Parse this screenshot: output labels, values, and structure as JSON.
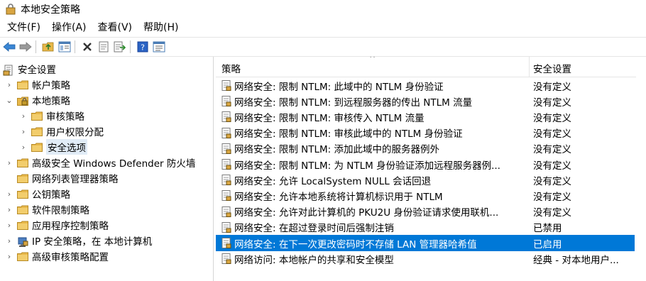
{
  "window": {
    "title": "本地安全策略"
  },
  "menu": [
    "文件(F)",
    "操作(A)",
    "查看(V)",
    "帮助(H)"
  ],
  "toolbar": {
    "icons": [
      "back-arrow-icon",
      "forward-arrow-icon",
      "up-folder-icon",
      "show-hide-tree-icon",
      "delete-icon",
      "properties-icon",
      "export-list-icon",
      "help-icon",
      "view-icon"
    ]
  },
  "tree": [
    {
      "label": "安全设置",
      "level": 0,
      "expanded": true
    },
    {
      "label": "帐户策略",
      "level": 1,
      "expanded": false
    },
    {
      "label": "本地策略",
      "level": 1,
      "expanded": true
    },
    {
      "label": "审核策略",
      "level": 2,
      "expanded": false
    },
    {
      "label": "用户权限分配",
      "level": 2,
      "expanded": false
    },
    {
      "label": "安全选项",
      "level": 2,
      "expanded": false,
      "selected": true
    },
    {
      "label": "高级安全 Windows Defender 防火墙",
      "level": 1,
      "expanded": false
    },
    {
      "label": "网络列表管理器策略",
      "level": 1,
      "expanded": null
    },
    {
      "label": "公钥策略",
      "level": 1,
      "expanded": false
    },
    {
      "label": "软件限制策略",
      "level": 1,
      "expanded": false
    },
    {
      "label": "应用程序控制策略",
      "level": 1,
      "expanded": false
    },
    {
      "label": "IP 安全策略，在 本地计算机",
      "level": 1,
      "expanded": false
    },
    {
      "label": "高级审核策略配置",
      "level": 1,
      "expanded": false
    }
  ],
  "table": {
    "headers": [
      "策略",
      "安全设置"
    ],
    "rows": [
      {
        "policy": "网络安全: 限制 NTLM: 此域中的 NTLM 身份验证",
        "setting": "没有定义"
      },
      {
        "policy": "网络安全: 限制 NTLM: 到远程服务器的传出 NTLM 流量",
        "setting": "没有定义"
      },
      {
        "policy": "网络安全: 限制 NTLM: 审核传入 NTLM 流量",
        "setting": "没有定义"
      },
      {
        "policy": "网络安全: 限制 NTLM: 审核此域中的 NTLM 身份验证",
        "setting": "没有定义"
      },
      {
        "policy": "网络安全: 限制 NTLM: 添加此域中的服务器例外",
        "setting": "没有定义"
      },
      {
        "policy": "网络安全: 限制 NTLM: 为 NTLM 身份验证添加远程服务器例...",
        "setting": "没有定义"
      },
      {
        "policy": "网络安全: 允许 LocalSystem NULL 会话回退",
        "setting": "没有定义"
      },
      {
        "policy": "网络安全: 允许本地系统将计算机标识用于 NTLM",
        "setting": "没有定义"
      },
      {
        "policy": "网络安全: 允许对此计算机的 PKU2U 身份验证请求使用联机...",
        "setting": "没有定义"
      },
      {
        "policy": "网络安全: 在超过登录时间后强制注销",
        "setting": "已禁用"
      },
      {
        "policy": "网络安全: 在下一次更改密码时不存储 LAN 管理器哈希值",
        "setting": "已启用",
        "selected": true
      },
      {
        "policy": "网络访问: 本地帐户的共享和安全模型",
        "setting": "经典 - 对本地用户..."
      }
    ]
  },
  "colors": {
    "selection": "#0078d7",
    "folder": "#e8b84a"
  }
}
